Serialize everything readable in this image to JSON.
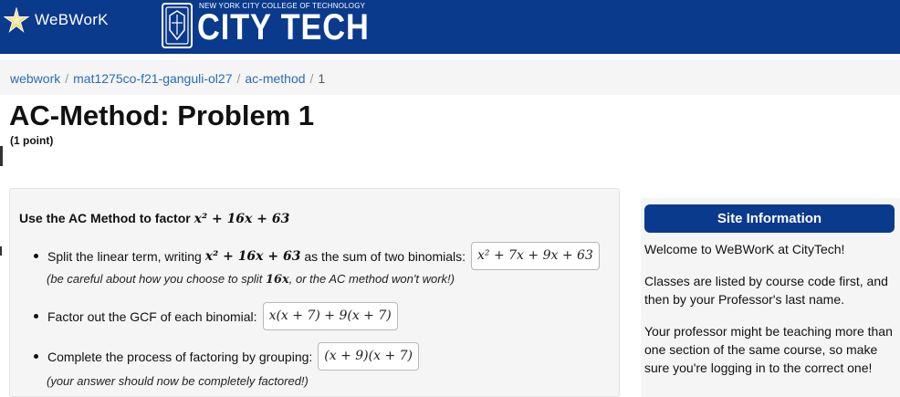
{
  "header": {
    "webwork_logo": "WeBWorK",
    "college_small": "NEW YORK CITY COLLEGE OF TECHNOLOGY",
    "college_big": "CITY TECH",
    "brand_color": "#0a3a8c"
  },
  "breadcrumb": {
    "items": [
      "webwork",
      "mat1275co-f21-ganguli-ol27",
      "ac-method"
    ],
    "current": "1",
    "separator": "/"
  },
  "problem": {
    "title": "AC-Method: Problem 1",
    "points": "(1 point)",
    "prompt_prefix": "Use the AC Method to factor",
    "prompt_expr": "x² + 16x + 63",
    "steps": [
      {
        "text": "Split the linear term, writing",
        "expr": "x² + 16x + 63",
        "text_after": "as the sum of two binomials:",
        "answer": "x² + 7x + 9x + 63",
        "hint_before": "(be careful about how you choose to split",
        "hint_expr": "16x",
        "hint_after": ", or the AC method won't work!)"
      },
      {
        "text": "Factor out the GCF of each binomial:",
        "answer": "x(x + 7) + 9(x + 7)"
      },
      {
        "text": "Complete the process of factoring by grouping:",
        "answer": "(x + 9)(x + 7)",
        "hint": "(your answer should now be completely factored!)"
      }
    ]
  },
  "site_info": {
    "heading": "Site Information",
    "paragraphs": [
      "Welcome to WeBWorK at CityTech!",
      "Classes are listed by course code first, and then by your Professor's last name.",
      "Your professor might be teaching more than one section of the same course, so make sure you're logging in to the correct one!"
    ]
  }
}
